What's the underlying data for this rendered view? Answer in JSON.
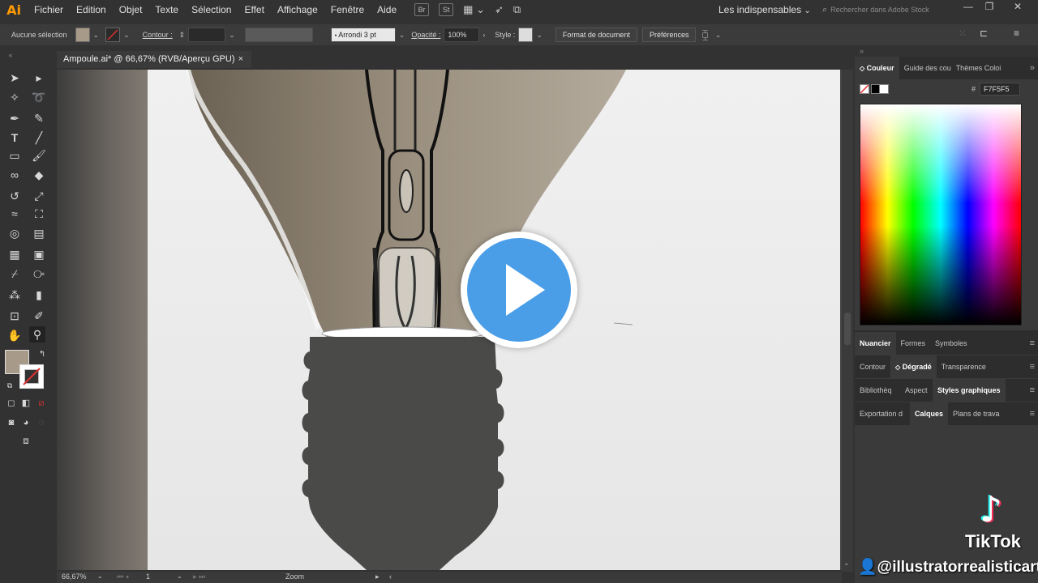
{
  "app": {
    "logo": "Ai"
  },
  "menu": [
    "Fichier",
    "Edition",
    "Objet",
    "Texte",
    "Sélection",
    "Effet",
    "Affichage",
    "Fenêtre",
    "Aide"
  ],
  "menu_icons": {
    "br": "Br",
    "st": "St"
  },
  "workspace": "Les indispensables",
  "search": {
    "placeholder": "Rechercher dans Adobe Stock"
  },
  "control": {
    "selection": "Aucune sélection",
    "contour_label": "Contour :",
    "brush": "Arrondi 3 pt",
    "opacity_label": "Opacité :",
    "opacity_value": "100%",
    "style_label": "Style :",
    "doc_format": "Format de document",
    "preferences": "Préférences",
    "fill_color": "#a89a88"
  },
  "document": {
    "tab_title": "Ampoule.ai* @ 66,67% (RVB/Aperçu GPU)",
    "close": "×"
  },
  "status": {
    "zoom": "66,67%",
    "artboard": "1",
    "tool": "Zoom"
  },
  "panels": {
    "color_tabs": [
      "Couleur",
      "Guide des coul",
      "Thèmes Coloi"
    ],
    "hex_label": "#",
    "hex_value": "F7F5F5",
    "row2": [
      "Nuancier",
      "Formes",
      "Symboles"
    ],
    "row3": [
      "Contour",
      "Dégradé",
      "Transparence"
    ],
    "row4": [
      "Bibliothèq",
      "Aspect",
      "Styles graphiques"
    ],
    "row5": [
      "Exportation d",
      "Calques",
      "Plans de trava"
    ]
  },
  "overlay": {
    "brand": "TikTok",
    "handle": "@illustratorrealisticart"
  }
}
